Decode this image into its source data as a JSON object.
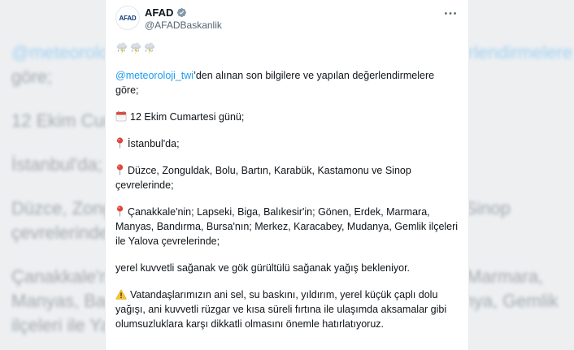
{
  "tweet": {
    "avatar_text": "AFAD",
    "name": "AFAD",
    "handle": "@AFADBaskanlik",
    "mention": "@meteoroloji_twi",
    "mention_suffix": "’den alınan son bilgilere ve yapılan değerlendirmelere göre;",
    "date_line": "12 Ekim Cumartesi günü;",
    "istanbul": "İstanbul'da;",
    "region1": "Düzce, Zonguldak, Bolu, Bartın, Karabük, Kastamonu ve Sinop çevrelerinde;",
    "region2": "Çanakkale'nin; Lapseki, Biga, Balıkesir'in; Gönen, Erdek, Marmara, Manyas, Bandırma, Bursa'nın; Merkez, Karacabey, Mudanya, Gemlik ilçeleri ile Yalova çevrelerinde;",
    "forecast": "yerel kuvvetli sağanak ve gök gürültülü sağanak yağış bekleniyor.",
    "warning": "Vatandaşlarımızın ani sel, su baskını, yıldırım, yerel küçük çaplı dolu yağışı, ani kuvvetli rüzgar ve kısa süreli fırtına ile ulaşımda aksamalar gibi olumsuzluklara karşı dikkatli olmasını önemle hatırlatıyoruz."
  },
  "background": {
    "lines": [
      "@meteoroloji_twi’den alınan son bilgilere ve yapılan değerlendirmelere",
      "göre;",
      "12 Ekim Cumartesi günü;",
      "İstanbul'da;",
      "Düzce, Zonguldak, Bolu, Bartın, Karabük, Kastamonu ve Sinop",
      "çevrelerinde;",
      "Çanakkale'nin; Lapseki, Biga, Balıkesir'in; Gönen, Erdek, Marmara,",
      "Manyas, Bandırma, Bursa'nın; Merkez, Karacabey, Mudanya, Gemlik",
      "ilçeleri ile Yalova çevrelerinde;"
    ]
  },
  "icons": {
    "verified": "verified-badge-icon",
    "more": "more-options-icon",
    "storm": "thunderstorm-cloud-icon",
    "calendar": "calendar-icon",
    "pin": "round-pushpin-icon",
    "warning": "warning-icon"
  },
  "colors": {
    "link": "#1d9bf0",
    "text": "#0f1419",
    "muted": "#536471",
    "verified": "#829aab"
  }
}
